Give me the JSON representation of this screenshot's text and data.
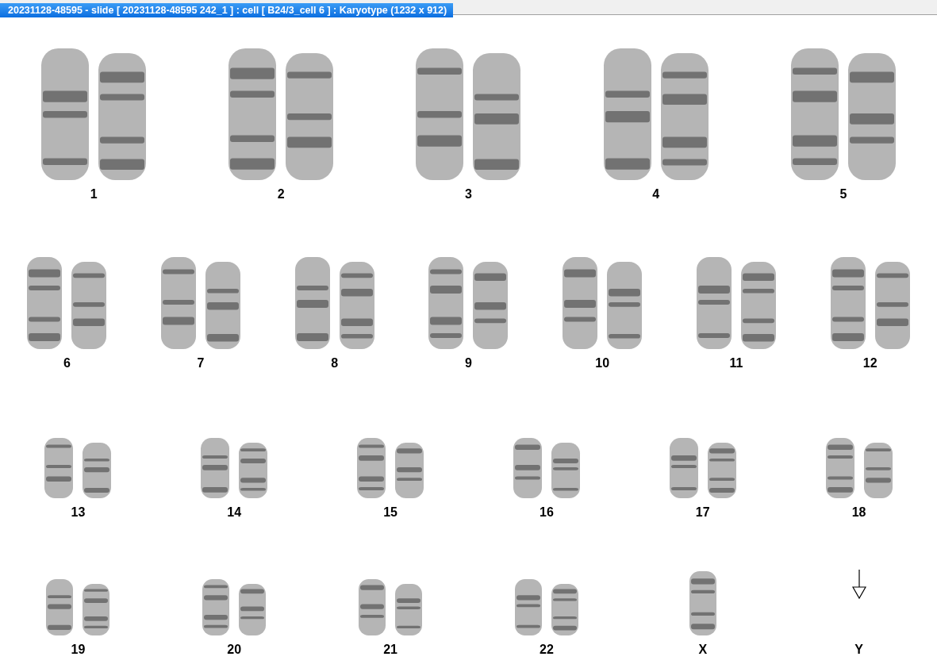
{
  "window": {
    "title": "20231128-48595 - slide [ 20231128-48595 242_1 ] : cell [ B24/3_cell 6 ] : Karyotype  (1232 x 912)"
  },
  "karyotype": {
    "rows": [
      {
        "groups": [
          {
            "label": "1",
            "kind": "pair"
          },
          {
            "label": "2",
            "kind": "pair"
          },
          {
            "label": "3",
            "kind": "pair"
          },
          {
            "label": "4",
            "kind": "pair"
          },
          {
            "label": "5",
            "kind": "pair"
          }
        ]
      },
      {
        "groups": [
          {
            "label": "6",
            "kind": "pair"
          },
          {
            "label": "7",
            "kind": "pair"
          },
          {
            "label": "8",
            "kind": "pair"
          },
          {
            "label": "9",
            "kind": "pair"
          },
          {
            "label": "10",
            "kind": "pair"
          },
          {
            "label": "11",
            "kind": "pair"
          },
          {
            "label": "12",
            "kind": "pair"
          }
        ]
      },
      {
        "groups": [
          {
            "label": "13",
            "kind": "pair"
          },
          {
            "label": "14",
            "kind": "pair"
          },
          {
            "label": "15",
            "kind": "pair"
          },
          {
            "label": "16",
            "kind": "pair"
          },
          {
            "label": "17",
            "kind": "pair"
          },
          {
            "label": "18",
            "kind": "pair"
          }
        ]
      },
      {
        "groups": [
          {
            "label": "19",
            "kind": "pair"
          },
          {
            "label": "20",
            "kind": "pair"
          },
          {
            "label": "21",
            "kind": "pair"
          },
          {
            "label": "22",
            "kind": "pair"
          },
          {
            "label": "X",
            "kind": "single"
          },
          {
            "label": "Y",
            "kind": "missing"
          }
        ]
      }
    ]
  }
}
